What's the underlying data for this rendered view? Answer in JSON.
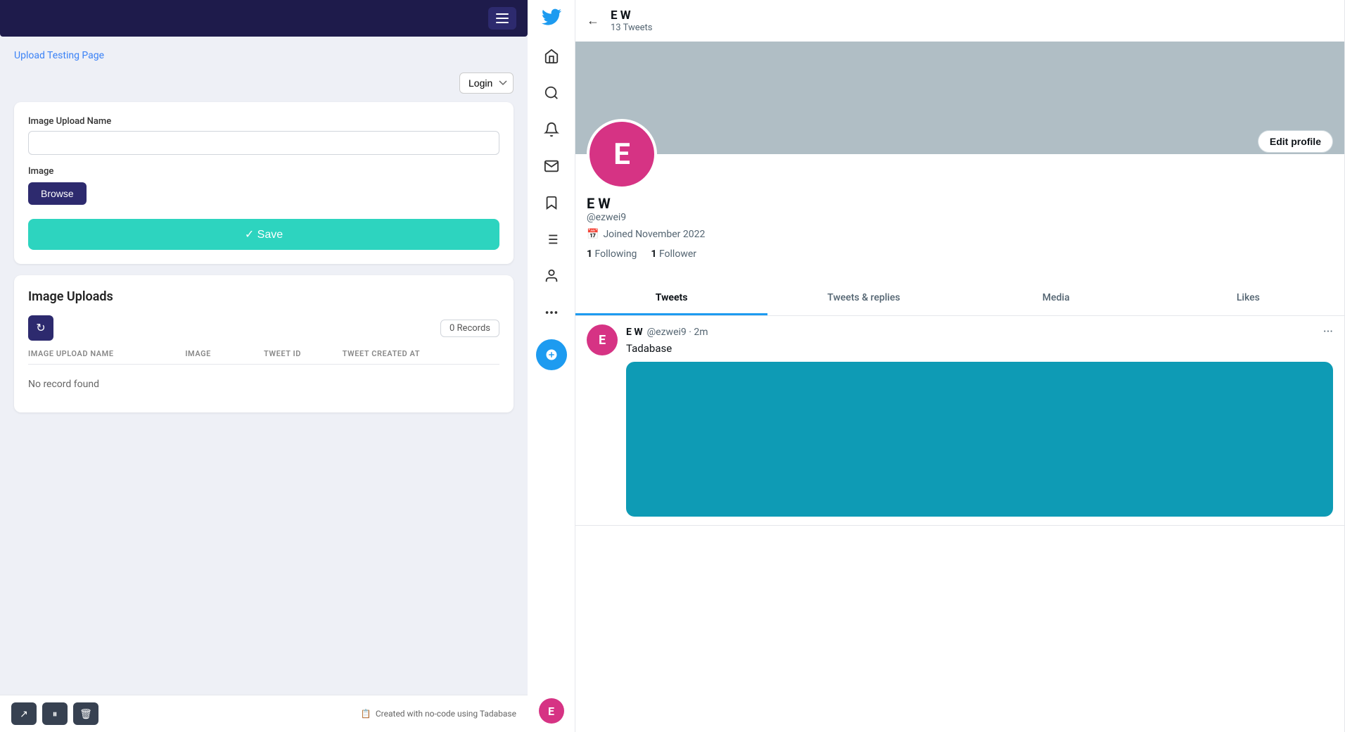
{
  "leftPanel": {
    "breadcrumb": "Upload Testing Page",
    "loginLabel": "Login",
    "form": {
      "imageUploadNameLabel": "Image Upload Name",
      "imageUploadNamePlaceholder": "",
      "imageLabel": "Image",
      "browseLabel": "Browse",
      "saveLabel": "✓ Save"
    },
    "imageUploads": {
      "title": "Image Uploads",
      "recordsCount": "0 Records",
      "columns": [
        "IMAGE UPLOAD NAME",
        "IMAGE",
        "TWEET ID",
        "TWEET CREATED AT"
      ],
      "emptyMessage": "No record found"
    },
    "footer": {
      "brandText": "Created with no-code using Tadabase"
    }
  },
  "rightPanel": {
    "profile": {
      "name": "E W",
      "tweetCount": "13 Tweets",
      "handle": "@ezwei9",
      "joinedDate": "Joined November 2022",
      "following": "1",
      "followingLabel": "Following",
      "followers": "1",
      "followersLabel": "Follower",
      "editProfileLabel": "Edit profile",
      "avatarInitial": "E"
    },
    "tabs": [
      "Tweets",
      "Tweets & replies",
      "Media",
      "Likes"
    ],
    "activeTab": "Tweets",
    "tweet": {
      "name": "E W",
      "handle": "@ezwei9",
      "time": "2m",
      "text": "Tadabase",
      "avatarInitial": "E"
    }
  },
  "icons": {
    "home": "⌂",
    "search": "🔍",
    "notifications": "🔔",
    "messages": "✉",
    "bookmarks": "🔖",
    "lists": "📋",
    "profile": "👤",
    "more": "···",
    "back": "←",
    "refresh": "↻",
    "twitterBird": "🐦",
    "externalLink": "↗",
    "pause": "⏸",
    "delete": "🗑"
  },
  "colors": {
    "navBg": "#1e1b4b",
    "accentBlue": "#1d9bf0",
    "saveBtnBg": "#2dd4bf",
    "avatarBg": "#d63384",
    "tweetImageBg": "#0e9bb5"
  }
}
